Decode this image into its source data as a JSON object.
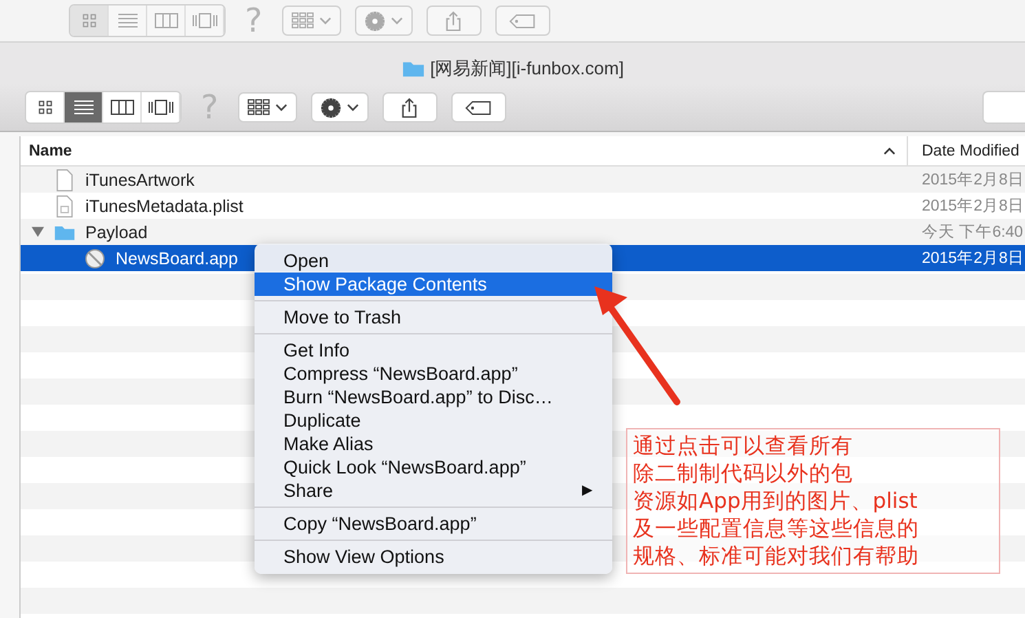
{
  "background_window": {
    "toolbar": {
      "active": false,
      "help": "?",
      "view_modes": [
        {
          "kind": "icons",
          "selected": true
        },
        {
          "kind": "list",
          "selected": false
        },
        {
          "kind": "columns",
          "selected": false
        },
        {
          "kind": "coverflow",
          "selected": false
        }
      ]
    }
  },
  "window": {
    "title": "[网易新闻][i-funbox.com]",
    "toolbar": {
      "active": true,
      "help": "?",
      "view_modes": [
        {
          "kind": "icons",
          "selected": false
        },
        {
          "kind": "list",
          "selected": true
        },
        {
          "kind": "columns",
          "selected": false
        },
        {
          "kind": "coverflow",
          "selected": false
        }
      ]
    }
  },
  "file_list": {
    "columns": [
      {
        "label": "Name",
        "sorted": true
      },
      {
        "label": "Date Modified"
      }
    ],
    "rows": [
      {
        "name": "iTunesArtwork",
        "kind": "file",
        "date": "2015年2月8日",
        "selected": false
      },
      {
        "name": "iTunesMetadata.plist",
        "kind": "plist",
        "date": "2015年2月8日",
        "selected": false
      },
      {
        "name": "Payload",
        "kind": "folder",
        "date": "今天 下午6:40",
        "selected": false,
        "expanded": true,
        "children": [
          {
            "name": "NewsBoard.app",
            "kind": "app",
            "date": "2015年2月8日",
            "selected": true
          }
        ]
      }
    ]
  },
  "context_menu": {
    "items": [
      {
        "kind": "item",
        "label": "Open",
        "selected": false
      },
      {
        "kind": "item",
        "label": "Show Package Contents",
        "selected": true
      },
      {
        "kind": "separator"
      },
      {
        "kind": "item",
        "label": "Move to Trash",
        "selected": false
      },
      {
        "kind": "separator"
      },
      {
        "kind": "item",
        "label": "Get Info",
        "selected": false
      },
      {
        "kind": "item",
        "label": "Compress “NewsBoard.app”",
        "selected": false
      },
      {
        "kind": "item",
        "label": "Burn “NewsBoard.app” to Disc…",
        "selected": false
      },
      {
        "kind": "item",
        "label": "Duplicate",
        "selected": false
      },
      {
        "kind": "item",
        "label": "Make Alias",
        "selected": false
      },
      {
        "kind": "item",
        "label": "Quick Look “NewsBoard.app”",
        "selected": false
      },
      {
        "kind": "item",
        "label": "Share",
        "selected": false,
        "submenu": "▶"
      },
      {
        "kind": "separator"
      },
      {
        "kind": "item",
        "label": "Copy “NewsBoard.app”",
        "selected": false
      },
      {
        "kind": "separator"
      },
      {
        "kind": "item",
        "label": "Show View Options",
        "selected": false
      }
    ]
  },
  "annotation": {
    "lines": [
      "通过点击可以查看所有",
      "除二制制代码以外的包",
      "资源如App用到的图片、plist",
      "及一些配置信息等这些信息的",
      "规格、标准可能对我们有帮助"
    ]
  }
}
